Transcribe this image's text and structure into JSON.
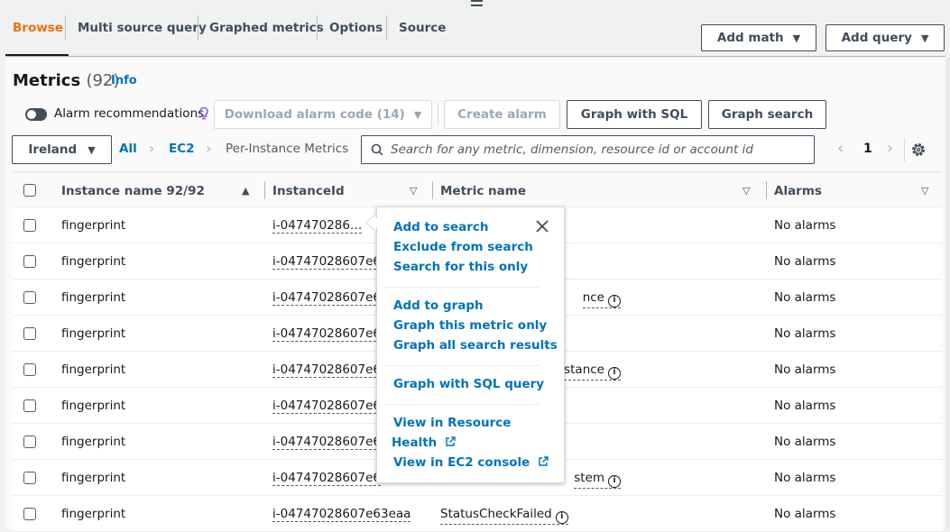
{
  "tabs": [
    {
      "label": "Browse",
      "active": true
    },
    {
      "label": "Multi source query",
      "active": false
    },
    {
      "label": "Graphed metrics",
      "active": false
    },
    {
      "label": "Options",
      "active": false
    },
    {
      "label": "Source",
      "active": false
    }
  ],
  "toolbar": {
    "add_math": "Add math",
    "add_query": "Add query"
  },
  "metrics": {
    "title": "Metrics",
    "count": "(92)",
    "info": "Info"
  },
  "actions": {
    "alarm_recommendations": "Alarm recommendations",
    "alarm_recommendations_on": false,
    "download_alarm_code": "Download alarm code (14)",
    "create_alarm": "Create alarm",
    "graph_with_sql": "Graph with SQL",
    "graph_search": "Graph search"
  },
  "filter": {
    "region": "Ireland",
    "breadcrumb": [
      "All",
      "EC2",
      "Per-Instance Metrics"
    ],
    "search_placeholder": "Search for any metric, dimension, resource id or account id",
    "search_value": "",
    "page": "1"
  },
  "table": {
    "columns": [
      "Instance name 92/92",
      "InstanceId",
      "Metric name",
      "Alarms"
    ],
    "rows": [
      {
        "instance_name": "fingerprint",
        "instance_id": "i-047470286…",
        "metric": "",
        "alarms": "No alarms"
      },
      {
        "instance_name": "fingerprint",
        "instance_id": "i-04747028607e6",
        "metric": "",
        "alarms": "No alarms"
      },
      {
        "instance_name": "fingerprint",
        "instance_id": "i-04747028607e6",
        "metric": "nce",
        "alarms": "No alarms"
      },
      {
        "instance_name": "fingerprint",
        "instance_id": "i-04747028607e6",
        "metric": "",
        "alarms": "No alarms"
      },
      {
        "instance_name": "fingerprint",
        "instance_id": "i-04747028607e6",
        "metric": "stance",
        "alarms": "No alarms"
      },
      {
        "instance_name": "fingerprint",
        "instance_id": "i-04747028607e6",
        "metric": "",
        "alarms": "No alarms"
      },
      {
        "instance_name": "fingerprint",
        "instance_id": "i-04747028607e6",
        "metric": "",
        "alarms": "No alarms"
      },
      {
        "instance_name": "fingerprint",
        "instance_id": "i-04747028607e6",
        "metric": "stem",
        "alarms": "No alarms"
      },
      {
        "instance_name": "fingerprint",
        "instance_id": "i-04747028607e63eaa",
        "metric": "StatusCheckFailed",
        "alarms": "No alarms"
      }
    ]
  },
  "popover": {
    "items": [
      "Add to search",
      "Exclude from search",
      "Search for this only",
      "Add to graph",
      "Graph this metric only",
      "Graph all search results",
      "Graph with SQL query",
      "View in Resource",
      "Health",
      "View in EC2 console"
    ]
  },
  "colors": {
    "accent": "#ec7211",
    "link": "#0073bb",
    "text": "#16191f"
  }
}
